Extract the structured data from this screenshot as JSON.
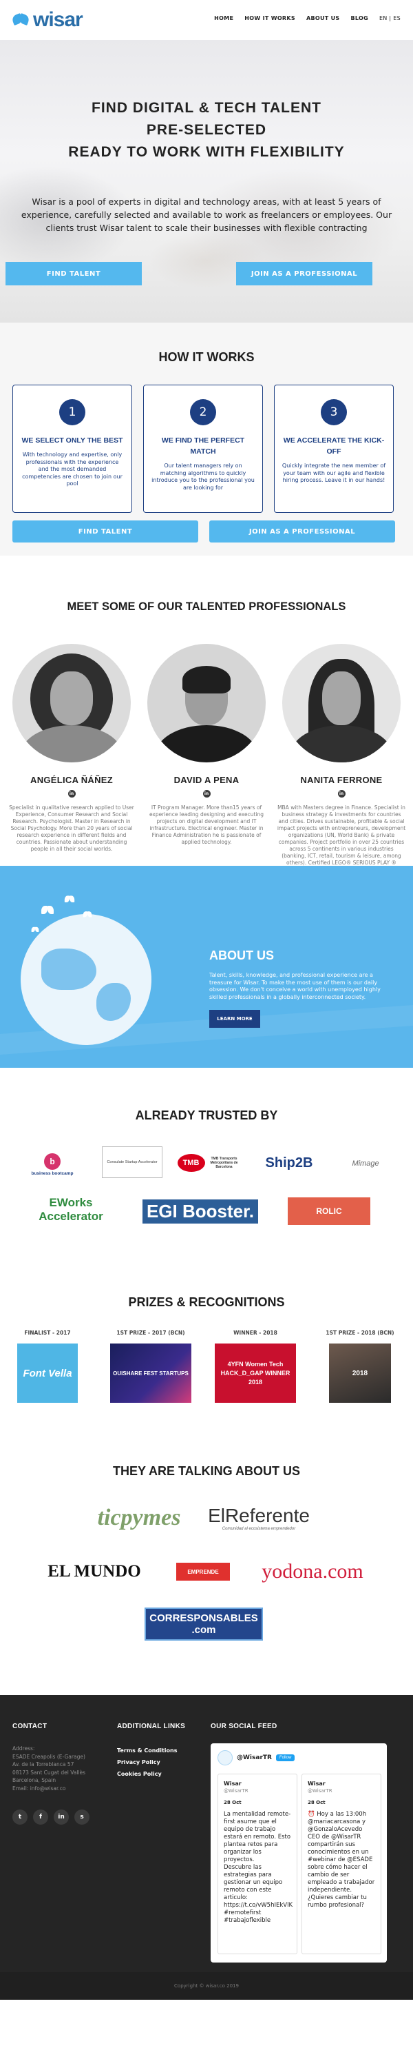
{
  "header": {
    "logo_text": "wisar",
    "nav": [
      "HOME",
      "HOW IT WORKS",
      "ABOUT US",
      "BLOG",
      "EN | ES"
    ]
  },
  "hero": {
    "title_lines": [
      "FIND DIGITAL & TECH TALENT",
      "PRE-SELECTED",
      "READY TO WORK WITH FLEXIBILITY"
    ],
    "text": "Wisar is a pool of experts in digital and technology areas, with at least 5 years of experience, carefully selected and available to work as freelancers or employees. Our clients trust Wisar talent to scale their businesses with flexible contracting",
    "btn_find": "FIND TALENT",
    "btn_join": "JOIN AS A PROFESSIONAL"
  },
  "how": {
    "title": "HOW IT WORKS",
    "steps": [
      {
        "num": "1",
        "title": "WE SELECT ONLY THE BEST",
        "text": "With technology and expertise, only professionals with the experience and the most demanded competencies are chosen to join our pool"
      },
      {
        "num": "2",
        "title": "WE FIND THE PERFECT MATCH",
        "text": "Our talent managers rely on matching algorithms to quickly introduce you to the professional you are looking for"
      },
      {
        "num": "3",
        "title": "WE ACCELERATE THE KICK-OFF",
        "text": "Quickly integrate the new member of your team with our agile and flexible hiring process. Leave it in our hands!"
      }
    ],
    "btn_find": "FIND TALENT",
    "btn_join": "JOIN AS A PROFESSIONAL"
  },
  "professionals": {
    "title": "MEET SOME OF OUR TALENTED PROFESSIONALS",
    "people": [
      {
        "name": "ANGÉLICA ÑÁÑEZ",
        "bio": "Specialist in qualitative research applied to User Experience, Consumer Research and Social Research. Psychologist. Master in Research in Social Psychology. More than 20 years of social research experience in different fields and countries. Passionate about understanding people in all their social worlds."
      },
      {
        "name": "DAVID A PENA",
        "bio": "IT Program Manager. More than15 years of experience leading designing and executing projects on digital development and IT infrastructure. Electrical engineer. Master in Finance Administration he is passionate of applied technology."
      },
      {
        "name": "NANITA FERRONE",
        "bio": "MBA with Masters degree in Finance. Specialist in business strategy & investments for countries and cities. Drives sustainable, profitable & social impact projects with entrepreneurs, development organizations (UN, World Bank) & private companies. Project portfolio in over 25 countries across 5 continents in various industries (banking, ICT, retail, tourism & leisure, among others). Certified LEGO® SERIOUS PLAY ® Facilitator"
      }
    ],
    "linkedin_icon": "in"
  },
  "about": {
    "title": "ABOUT US",
    "text": "Talent, skills, knowledge, and professional experience are a treasure for Wisar. To make the most use of them is our daily obsession. We don't conceive a world with unemployed highly skilled professionals in a globally interconnected society.",
    "btn": "LEARN MORE"
  },
  "trusted": {
    "title": "ALREADY TRUSTED BY",
    "logos": [
      "business bootcamp",
      "Consulate Startup Accelerator",
      "TMB Transports Metropolitans de Barcelona",
      "Ship2B",
      "Mimage",
      "EWorks Accelerator",
      "EGI Booster.",
      "ROLIC"
    ]
  },
  "prizes": {
    "title": "PRIZES & RECOGNITIONS",
    "items": [
      {
        "label": "FINALIST - 2017",
        "img_text": "Font Vella"
      },
      {
        "label": "1ST PRIZE - 2017 (BCN)",
        "img_text": "OUISHARE FEST STARTUPS"
      },
      {
        "label": "WINNER - 2018",
        "img_text": "4YFN Women Tech HACK_D_GAP WINNER 2018"
      },
      {
        "label": "1ST PRIZE - 2018 (BCN)",
        "img_text": "2018"
      }
    ]
  },
  "press": {
    "title": "THEY ARE TALKING ABOUT US",
    "logos": [
      "ticpymes",
      "ElReferente",
      "Comunidad al ecosistema emprendedor",
      "EL MUNDO",
      "EMPRENDE",
      "yodona.com",
      "CORRESPONSABLES .com"
    ]
  },
  "footer": {
    "contact_title": "CONTACT",
    "contact_lines": [
      "Address:",
      "ESADE Creapolis (E-Garage)",
      "Av. de la Torreblanca 57",
      "08173 Sant Cugat del Vallès",
      "Barcelona, Spain",
      "Email: info@wisar.co"
    ],
    "links_title": "ADDITIONAL LINKS",
    "links": [
      "Terms & Conditions",
      "Privacy Policy",
      "Cookies Policy"
    ],
    "social_title": "OUR SOCIAL FEED",
    "social_icons": [
      "t",
      "f",
      "in",
      "s"
    ],
    "feed": {
      "handle": "@WisarTR",
      "follow": "Follow",
      "tweets": [
        {
          "user": "Wisar",
          "handle": "@WisarTR",
          "date": "28 Oct",
          "body": "La mentalidad remote-first asume que el equipo de trabajo estará en remoto. Esto plantea retos para organizar los proyectos.\nDescubre las estrategias para gestionar un equipo remoto con este articulo:\nhttps://t.co/vW5hIEkVlK\n#remotefirst #trabajoflexible"
        },
        {
          "user": "Wisar",
          "handle": "@WisarTR",
          "date": "28 Oct",
          "body": "⏰ Hoy a las 13:00h @mariacarcasona y @GonzaloAcevedo CEO de @WisarTR compartirán sus conocimientos en un #webinar de @ESADE sobre cómo hacer el cambio de ser empleado a trabajador independiente. ¿Quieres cambiar tu rumbo profesional?"
        }
      ]
    },
    "copyright": "Copyright © wisar.co 2019"
  }
}
